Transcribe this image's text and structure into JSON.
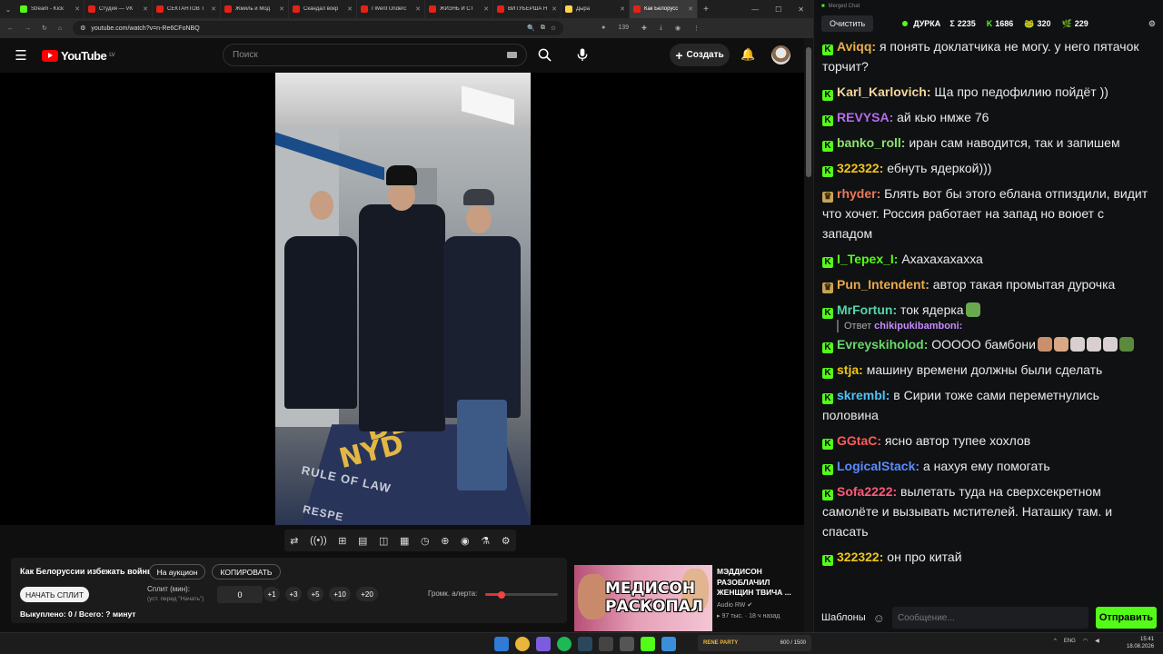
{
  "browser": {
    "tabs": [
      {
        "label": "Stream - Kick",
        "color": "#53fc18",
        "active": false
      },
      {
        "label": "Студия — VK",
        "color": "#e62117",
        "active": false
      },
      {
        "label": "СЕКТАНТОВ Т",
        "color": "#e62117",
        "active": false
      },
      {
        "label": "Жмиль и Мод",
        "color": "#e62117",
        "active": false
      },
      {
        "label": "Скандал вокр",
        "color": "#e62117",
        "active": false
      },
      {
        "label": "I Went Underc",
        "color": "#e62117",
        "active": false
      },
      {
        "label": "ЖИЗНЬ И СТ",
        "color": "#e62117",
        "active": false
      },
      {
        "label": "ВИТУБЕРША Н",
        "color": "#e62117",
        "active": false
      },
      {
        "label": "Дыра",
        "color": "#ffd34d",
        "active": false
      },
      {
        "label": "Как Белорусс",
        "color": "#e62117",
        "active": true
      }
    ],
    "new_tab": "+",
    "url": "youtube.com/watch?v=n-Re6CFoNBQ",
    "ext_badge": "139"
  },
  "youtube": {
    "logo": "YouTube",
    "region": "LV",
    "search_placeholder": "Поиск",
    "create_label": "Создать"
  },
  "video": {
    "floor_text_1": "DEA",
    "floor_text_2": "NYD",
    "floor_text_3": "RULE OF LAW",
    "floor_text_4": "RESPE"
  },
  "player_controls": [
    "⇄",
    "((•))",
    "⊞",
    "▤",
    "◫",
    "▦",
    "◷",
    "⊕",
    "◉",
    "⚗",
    "⚙"
  ],
  "panel": {
    "title": "Как Белоруссии избежать войны",
    "auction": "На аукцион",
    "copy": "КОПИРОВАТЬ",
    "start_split": "НАЧАТЬ СПЛИТ",
    "split_label": "Сплит (мин):",
    "split_hint": "(уст. перед \"Начать\")",
    "split_value": "0",
    "increments": [
      "+1",
      "+3",
      "+5",
      "+10",
      "+20"
    ],
    "volume_label": "Громк. алерта:",
    "volume_level": 0.22,
    "bought": "Выкуплено: 0 / Всего: ? минут"
  },
  "recommended": {
    "thumb_text": "МЕДИСОН РАСКОПАЛ",
    "title": "МЭДДИСОН РАЗОБЛАЧИЛ ЖЕНЩИН ТВИЧА ...",
    "channel": "Audio RW",
    "views": "97 тыс.",
    "age": "18 ч назад"
  },
  "chat": {
    "window_title": "Merged Chat",
    "clear": "Очистить",
    "channel": "ДУРКА",
    "stats": [
      {
        "icon": "Σ",
        "value": "2235"
      },
      {
        "icon": "K",
        "value": "1686"
      },
      {
        "icon": "🐸",
        "value": "320"
      },
      {
        "icon": "🌿",
        "value": "229"
      }
    ],
    "messages": [
      {
        "user": "Aviqq",
        "color": "#e8b04a",
        "badge": "kick",
        "text": "я понять доклатчика не могу. у него пятачок торчит?"
      },
      {
        "user": "Karl_Karlovich",
        "color": "#f4d59b",
        "badge": "kick",
        "text": "Ща про педофилию пойдёт ))"
      },
      {
        "user": "REVYSA",
        "color": "#b56cf0",
        "badge": "kick",
        "text": "ай кью нмже 76"
      },
      {
        "user": "banko_roll",
        "color": "#8de26a",
        "badge": "kick",
        "text": "иран сам наводится, так и запишем"
      },
      {
        "user": "322322",
        "color": "#f0c419",
        "badge": "kick",
        "text": "ебнуть ядеркой)))"
      },
      {
        "user": "rhyder",
        "color": "#e87a5a",
        "badge": "vip",
        "text": "Блять вот бы этого еблана отпиздили, видит что хочет. Россия работает на запад но воюет с западом"
      },
      {
        "user": "I_Tepex_I",
        "color": "#53fc18",
        "badge": "kick",
        "text": "Ахахахахахха"
      },
      {
        "user": "Pun_Intendent",
        "color": "#e9a94a",
        "badge": "vip",
        "text": "автор такая промытая дурочка"
      },
      {
        "user": "MrFortun",
        "color": "#53d6a8",
        "badge": "kick",
        "text": "ток ядерка"
      },
      {
        "user": "Evreyskiholod",
        "color": "#6ad96a",
        "badge": "kick",
        "text": "ООООО бамбони",
        "reply_label": "Ответ",
        "reply_user": "chikipukibamboni:"
      },
      {
        "user": "stja",
        "color": "#f0c419",
        "badge": "kick",
        "text": "машину времени должны были сделать"
      },
      {
        "user": "skrembl",
        "color": "#4fc3f7",
        "badge": "kick",
        "text": "в Сирии тоже сами переметнулись половина"
      },
      {
        "user": "GGtaC",
        "color": "#ff5a5a",
        "badge": "kick",
        "text": "ясно автор тупее хохлов"
      },
      {
        "user": "LogicalStack",
        "color": "#5a8cff",
        "badge": "kick",
        "text": "а нахуя ему помогать"
      },
      {
        "user": "Sofa2222",
        "color": "#ff5a7a",
        "badge": "kick",
        "text": "вылетать туда на сверхсекретном самолёте и вызывать мстителей. Наташку там. и спасать"
      },
      {
        "user": "322322",
        "color": "#f0c419",
        "badge": "kick",
        "text": "он про китай"
      }
    ],
    "templates": "Шаблоны",
    "input_placeholder": "Сообщение...",
    "send": "Отправить"
  },
  "taskbar": {
    "widget_name": "RENE PARTY",
    "widget_value": "600 / 1500",
    "lang": "ENG",
    "time": "15:41",
    "date": "18.08.2026"
  }
}
